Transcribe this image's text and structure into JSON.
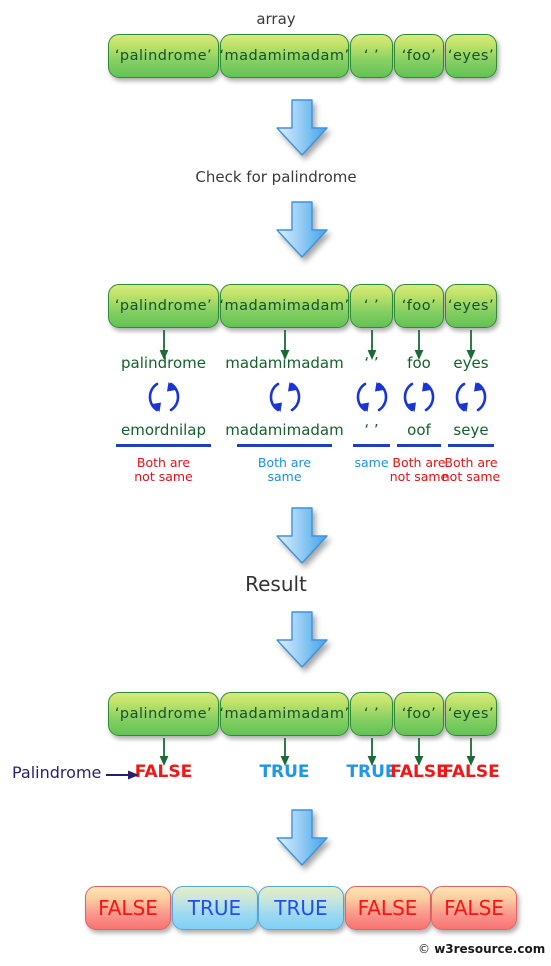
{
  "labels": {
    "array_title": "array",
    "check_title": "Check for palindrome",
    "result_title": "Result",
    "palindrome_label": "Palindrome",
    "watermark_c": "©",
    "watermark_text": "w3resource.com"
  },
  "array": {
    "items": [
      {
        "quoted": "‘palindrome’",
        "plain": "palindrome"
      },
      {
        "quoted": "‘madamimadam’",
        "plain": "madamimadam"
      },
      {
        "quoted": "‘  ’",
        "plain": "‘  ’"
      },
      {
        "quoted": "‘foo’",
        "plain": "foo"
      },
      {
        "quoted": "‘eyes’",
        "plain": "eyes"
      }
    ]
  },
  "check": {
    "forward": [
      "palindrome",
      "madamimadam",
      "‘  ’",
      "foo",
      "eyes"
    ],
    "reversed": [
      "emordnilap",
      "madamimadam",
      "‘  ’",
      "oof",
      "seye"
    ],
    "verdicts": [
      {
        "line1": "Both are",
        "line2": "not same",
        "color": "red"
      },
      {
        "line1": "Both are",
        "line2": "same",
        "color": "blue"
      },
      {
        "line1": "same",
        "line2": "",
        "color": "blue"
      },
      {
        "line1": "Both are",
        "line2": "not same",
        "color": "red"
      },
      {
        "line1": "Both are",
        "line2": "not same",
        "color": "red"
      }
    ]
  },
  "result": {
    "values": [
      "FALSE",
      "TRUE",
      "TRUE",
      "FALSE",
      "FALSE"
    ],
    "kinds": [
      "f",
      "t",
      "t",
      "f",
      "f"
    ]
  },
  "final": {
    "values": [
      "FALSE",
      "TRUE",
      "TRUE",
      "FALSE",
      "FALSE"
    ],
    "kinds": [
      "false",
      "true",
      "true",
      "false",
      "false"
    ]
  },
  "colors": {
    "green_border": "#2e8b33",
    "green_text": "#14532d",
    "blue_arrow": "#4aa3e8",
    "red": "#e11414",
    "blue": "#1f8fe0",
    "navy": "#2b1f6b",
    "underline": "#1f3fbf"
  }
}
